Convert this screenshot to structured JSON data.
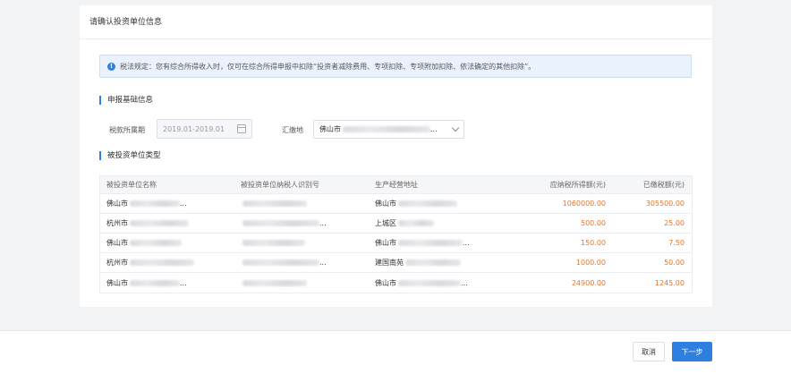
{
  "card": {
    "title": "请确认投资单位信息"
  },
  "notice": {
    "text": "税法规定：您有综合所得收入时，仅可在综合所得申报中扣除“投资者减除费用、专项扣除、专项附加扣除、依法确定的其他扣除”。"
  },
  "basic_info": {
    "section_title": "申报基础信息",
    "period_label": "税款所属期",
    "period_value": "2019.01-2019.01",
    "place_label": "汇缴地",
    "place_value_prefix": "佛山市",
    "place_value_suffix": "..."
  },
  "investee": {
    "section_title": "被投资单位类型",
    "headers": [
      "被投资单位名称",
      "被投资单位纳税人识别号",
      "生产经营地址",
      "应纳税所得额(元)",
      "已缴税额(元)"
    ],
    "rows": [
      {
        "name": "佛山市",
        "name_suffix": "...",
        "taxid_suffix": "",
        "addr": "佛山市",
        "addr_suffix": "",
        "income": "1060000.00",
        "paid": "305500.00"
      },
      {
        "name": "杭州市",
        "name_suffix": "",
        "taxid_suffix": "...",
        "addr": "上城区",
        "addr_suffix": "",
        "income": "500.00",
        "paid": "25.00"
      },
      {
        "name": "佛山市",
        "name_suffix": "",
        "taxid_suffix": "",
        "addr": "佛山市",
        "addr_suffix": "...",
        "income": "150.00",
        "paid": "7.50"
      },
      {
        "name": "杭州市",
        "name_suffix": "",
        "taxid_suffix": "...",
        "addr": "建国南苑",
        "addr_suffix": "",
        "income": "1000.00",
        "paid": "50.00"
      },
      {
        "name": "佛山市",
        "name_suffix": "...",
        "taxid_suffix": "",
        "addr": "佛山市",
        "addr_suffix": "...",
        "income": "24900.00",
        "paid": "1245.00"
      }
    ]
  },
  "footer": {
    "cancel_label": "取消",
    "next_label": "下一步"
  },
  "colors": {
    "accent": "#2e7fe0",
    "amount": "#e5762c"
  }
}
